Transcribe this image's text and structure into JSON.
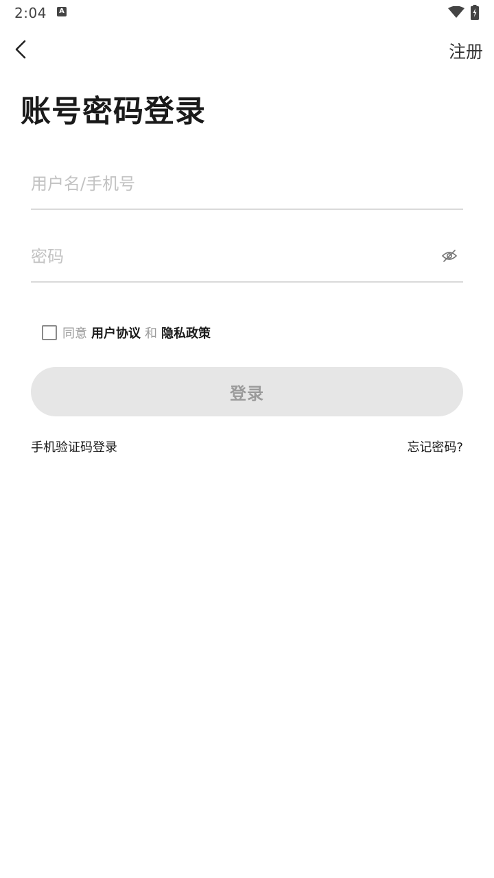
{
  "status_bar": {
    "time": "2:04",
    "notification_icon": "keyboard-a-icon",
    "wifi_icon": "wifi-icon",
    "battery_icon": "battery-charging-icon"
  },
  "nav": {
    "back_icon": "chevron-left-icon",
    "register_label": "注册"
  },
  "title": "账号密码登录",
  "form": {
    "username_placeholder": "用户名/手机号",
    "username_value": "",
    "password_placeholder": "密码",
    "password_value": "",
    "password_toggle_icon": "eye-off-icon"
  },
  "agreement": {
    "checked": false,
    "prefix": "同意",
    "user_agreement": "用户协议",
    "and": "和",
    "privacy_policy": "隐私政策"
  },
  "login_button": {
    "label": "登录",
    "enabled": false,
    "background": "#e6e6e6",
    "text_color": "#9b9b9b"
  },
  "links": {
    "sms_login": "手机验证码登录",
    "forgot_password": "忘记密码?"
  }
}
